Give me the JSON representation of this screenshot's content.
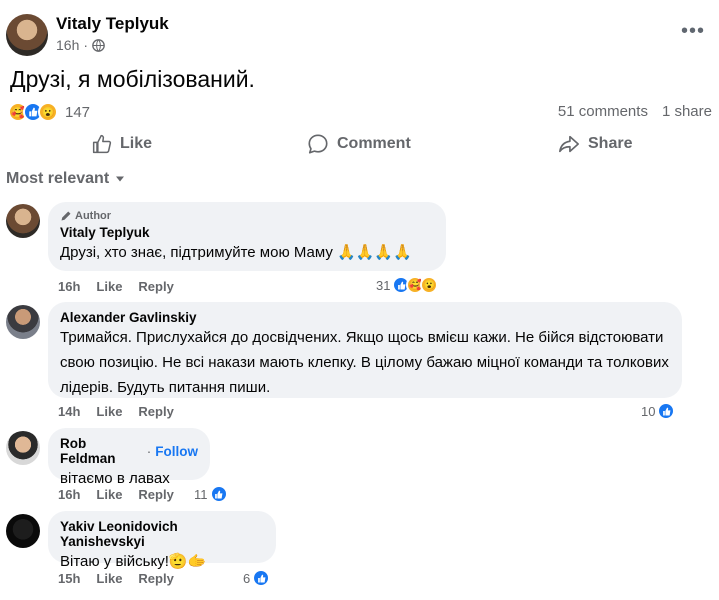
{
  "post": {
    "author": "Vitaly Teplyuk",
    "time": "16h",
    "text": "Друзі, я мобілізований.",
    "reaction_count": "147",
    "comments_count": "51 comments",
    "shares_count": "1 share",
    "more_label": "•••"
  },
  "actions": {
    "like": "Like",
    "comment": "Comment",
    "share": "Share"
  },
  "sort_label": "Most relevant",
  "comments": [
    {
      "badge": "Author",
      "author": "Vitaly Teplyuk",
      "text": "Друзі, хто знає, підтримуйте мою Маму 🙏🙏🙏🙏",
      "time": "16h",
      "like": "Like",
      "reply": "Reply",
      "reactions": "31"
    },
    {
      "author": "Alexander Gavlinskiy",
      "text": "Тримайся. Прислухайся до досвідчених. Якщо щось вмієш кажи. Не бійся відстоювати свою позицію. Не всі накази мають клепку. В цілому бажаю міцної команди та толкових лідерів. Будуть питання пиши.",
      "time": "14h",
      "like": "Like",
      "reply": "Reply",
      "reactions": "10"
    },
    {
      "author": "Rob Feldman",
      "follow": "Follow",
      "separator": "·",
      "text": "вітаємо в лавах",
      "time": "16h",
      "like": "Like",
      "reply": "Reply",
      "reactions": "11"
    },
    {
      "author": "Yakiv Leonidovich Yanishevskyi",
      "text": "Вітаю у війську!🫡🫱",
      "time": "15h",
      "like": "Like",
      "reply": "Reply",
      "reactions": "6"
    }
  ],
  "colors": {
    "accent": "#1877f2",
    "secondary_text": "#65676b",
    "bubble": "#f0f2f5"
  }
}
